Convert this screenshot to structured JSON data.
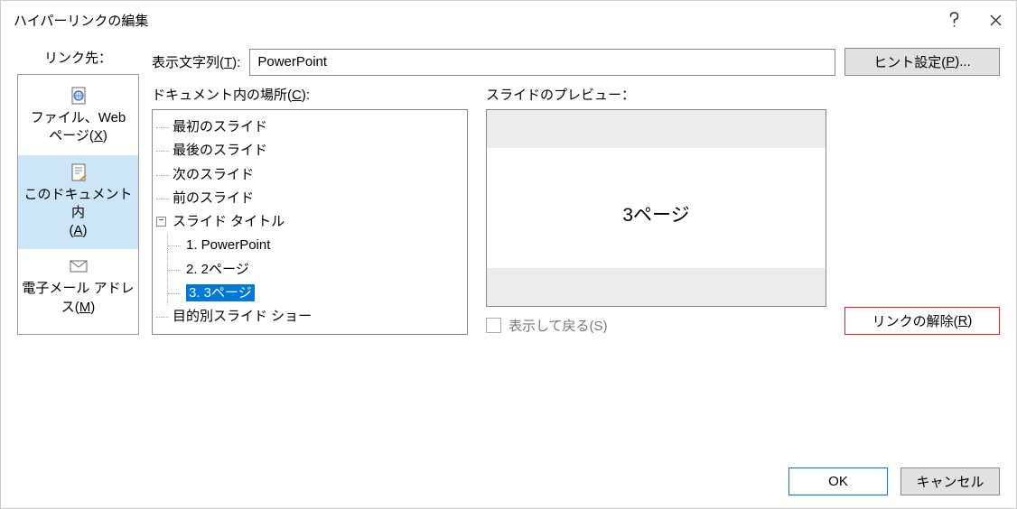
{
  "dialog": {
    "title": "ハイパーリンクの編集"
  },
  "left": {
    "label": "リンク先：",
    "options": [
      {
        "line1": "ファイル、Web",
        "line2": "ページ(",
        "key": "X",
        "tail": ")"
      },
      {
        "line1": "このドキュメント内",
        "line2": "(",
        "key": "A",
        "tail": ")"
      },
      {
        "line1": "電子メール アドレ",
        "line2": "ス(",
        "key": "M",
        "tail": ")"
      }
    ]
  },
  "display": {
    "label_pre": "表示文字列(",
    "label_key": "T",
    "label_post": "):",
    "value": "PowerPoint"
  },
  "hint": {
    "label_pre": "ヒント設定(",
    "label_key": "P",
    "label_post": ")..."
  },
  "location": {
    "label_pre": "ドキュメント内の場所(",
    "label_key": "C",
    "label_post": "):",
    "roots": [
      "最初のスライド",
      "最後のスライド",
      "次のスライド",
      "前のスライド"
    ],
    "titlesGroup": "スライド タイトル",
    "titles": [
      "1. PowerPoint",
      "2. 2ページ",
      "3. 3ページ"
    ],
    "custom": "目的別スライド ショー",
    "selectedIndex": 2
  },
  "preview": {
    "label": "スライドのプレビュー：",
    "text": "3ページ"
  },
  "showreturn": {
    "label_pre": "表示して戻る(",
    "label_key": "S",
    "label_post": ")"
  },
  "removelink": {
    "label_pre": "リンクの解除(",
    "label_key": "R",
    "label_post": ")"
  },
  "buttons": {
    "ok": "OK",
    "cancel": "キャンセル"
  }
}
